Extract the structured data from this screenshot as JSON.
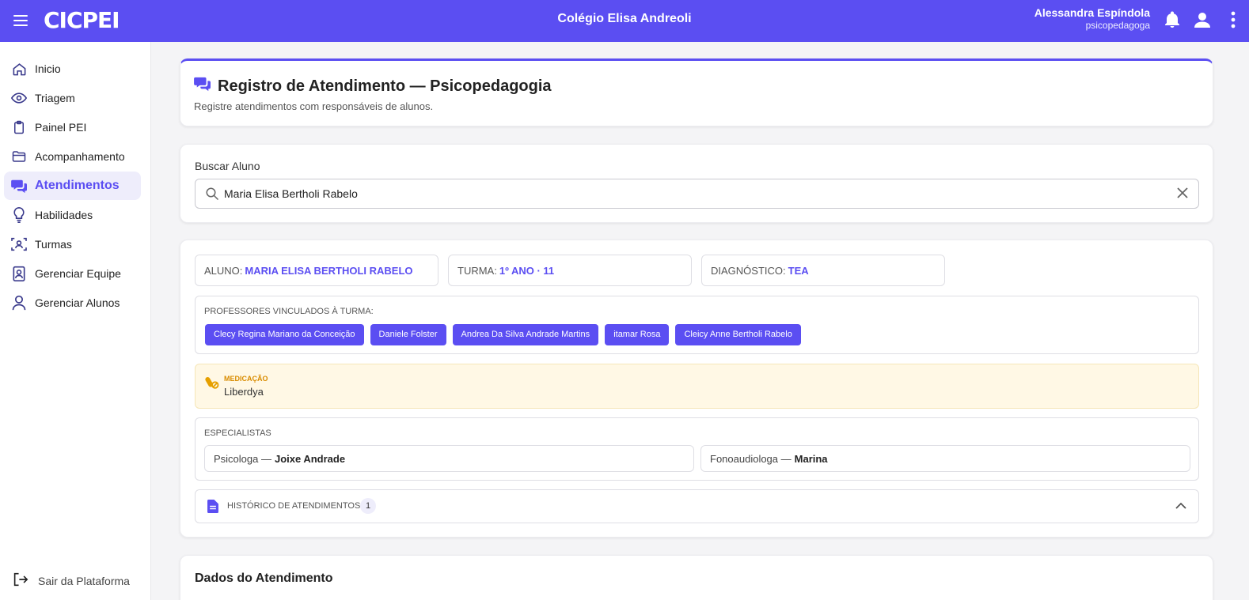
{
  "header": {
    "logo": "CICPEI",
    "school": "Colégio Elisa Andreoli",
    "user_name": "Alessandra Espíndola",
    "user_role": "psicopedagoga"
  },
  "sidebar": {
    "items": [
      {
        "label": "Inicio",
        "icon": "home-icon"
      },
      {
        "label": "Triagem",
        "icon": "eye-icon"
      },
      {
        "label": "Painel PEI",
        "icon": "clipboard-icon"
      },
      {
        "label": "Acompanhamento",
        "icon": "folder-icon"
      },
      {
        "label": "Atendimentos",
        "icon": "chat-icon"
      },
      {
        "label": "Habilidades",
        "icon": "lightbulb-icon"
      },
      {
        "label": "Turmas",
        "icon": "group-icon"
      },
      {
        "label": "Gerenciar Equipe",
        "icon": "badge-icon"
      },
      {
        "label": "Gerenciar Alunos",
        "icon": "person-icon"
      }
    ],
    "active_index": 4,
    "logout": "Sair da Plataforma"
  },
  "page": {
    "title": "Registro de Atendimento — Psicopedagogia",
    "subtitle": "Registre atendimentos com responsáveis de alunos."
  },
  "search": {
    "label": "Buscar Aluno",
    "value": "Maria Elisa Bertholi Rabelo"
  },
  "student": {
    "aluno_label": "ALUNO:",
    "aluno_value": "MARIA ELISA BERTHOLI RABELO",
    "turma_label": "TURMA:",
    "turma_value": "1º ANO · 11",
    "diag_label": "DIAGNÓSTICO:",
    "diag_value": "TEA"
  },
  "professores": {
    "title": "PROFESSORES VINCULADOS À TURMA:",
    "list": [
      "Clecy Regina Mariano da Conceição",
      "Daniele Folster",
      "Andrea Da Silva Andrade Martins",
      "itamar Rosa",
      "Cleicy Anne Bertholi Rabelo"
    ]
  },
  "medicacao": {
    "title": "MEDICAÇÃO",
    "value": "Liberdya"
  },
  "especialistas": {
    "title": "ESPECIALISTAS",
    "list": [
      {
        "role": "Psicologa —",
        "name": "Joixe Andrade"
      },
      {
        "role": "Fonoaudiologa —",
        "name": "Marina"
      }
    ]
  },
  "historico": {
    "title": "HISTÓRICO DE ATENDIMENTOS",
    "count": "1"
  },
  "dados": {
    "title": "Dados do Atendimento"
  },
  "colors": {
    "primary": "#5b4ef2",
    "med_bg": "#fff8e5",
    "med_accent": "#d98c00"
  }
}
